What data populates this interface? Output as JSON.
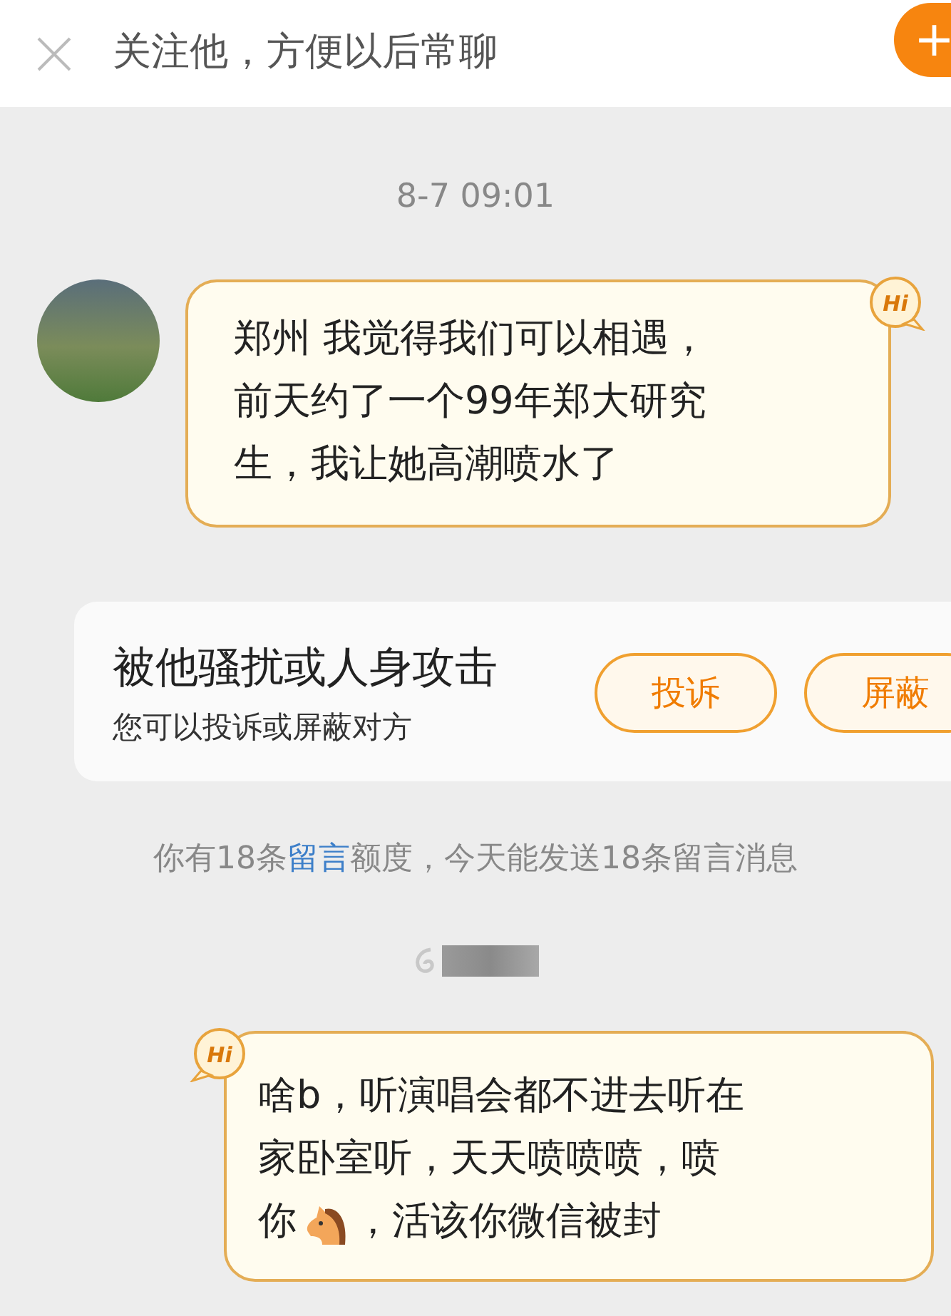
{
  "header": {
    "title": "关注他，方便以后常聊",
    "follow_button": "+"
  },
  "messages": [
    {
      "kind": "time",
      "text": "8-7 09:01"
    },
    {
      "kind": "incoming",
      "lines": [
        "郑州  我觉得我们可以相遇，",
        "前天约了一个99年郑大研究",
        "生，我让她高潮喷水了"
      ],
      "badge": "Hi"
    },
    {
      "kind": "report",
      "title": "被他骚扰或人身攻击",
      "subtitle": "您可以投诉或屏蔽对方",
      "buttons": [
        "投诉",
        "屏蔽"
      ]
    },
    {
      "kind": "notice",
      "before": "你有18条",
      "link": "留言",
      "after": "额度，今天能发送18条留言消息"
    },
    {
      "kind": "redacted"
    },
    {
      "kind": "outgoing",
      "lines": [
        "啥b，听演唱会都不进去听在",
        "家卧室听，天天喷喷喷，喷"
      ],
      "last_before": "你",
      "has_horse": true,
      "last_after": "，活该你微信被封",
      "badge": "Hi"
    }
  ]
}
